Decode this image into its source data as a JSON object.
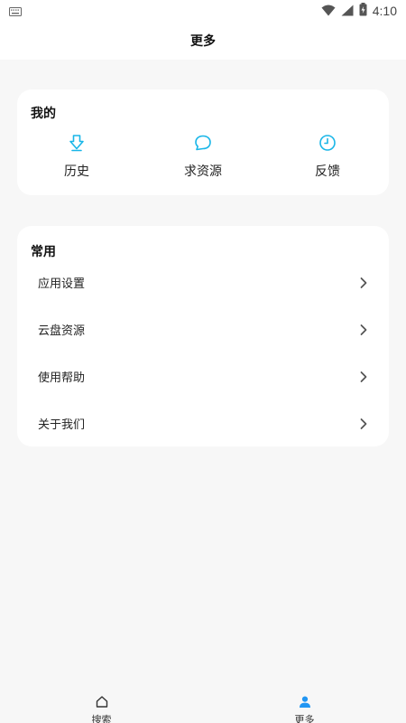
{
  "status_bar": {
    "time": "4:10"
  },
  "header": {
    "title": "更多"
  },
  "mine": {
    "title": "我的",
    "items": [
      {
        "label": "历史",
        "icon": "download-arrow-icon"
      },
      {
        "label": "求资源",
        "icon": "chat-bubble-icon"
      },
      {
        "label": "反馈",
        "icon": "clock-icon"
      }
    ]
  },
  "common": {
    "title": "常用",
    "items": [
      {
        "label": "应用设置"
      },
      {
        "label": "云盘资源"
      },
      {
        "label": "使用帮助"
      },
      {
        "label": "关于我们"
      }
    ]
  },
  "bottom_nav": {
    "items": [
      {
        "label": "搜索",
        "icon": "home-icon"
      },
      {
        "label": "更多",
        "icon": "user-icon"
      }
    ],
    "active_color": "#2196f3"
  },
  "colors": {
    "accent": "#19b6e8",
    "background": "#f7f7f7",
    "card": "#ffffff"
  }
}
